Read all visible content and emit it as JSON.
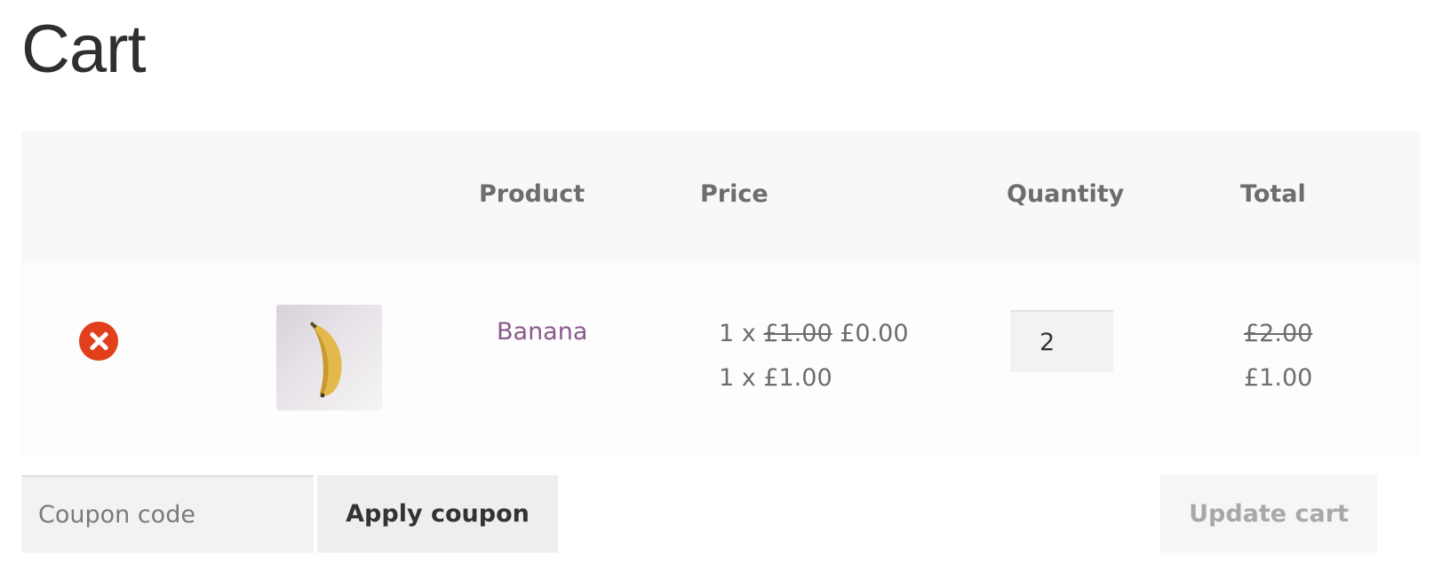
{
  "page": {
    "title": "Cart"
  },
  "table": {
    "headers": {
      "product": "Product",
      "price": "Price",
      "quantity": "Quantity",
      "total": "Total"
    },
    "rows": [
      {
        "product_name": "Banana",
        "image_icon": "banana-product-image",
        "remove_icon": "remove-circle-x-icon",
        "price_lines": [
          {
            "prefix": "1 x ",
            "original": "£1.00",
            "discounted": "£0.00"
          },
          {
            "text": "1 x £1.00"
          }
        ],
        "quantity": "2",
        "total_original": "£2.00",
        "total": "£1.00"
      }
    ]
  },
  "coupon": {
    "placeholder": "Coupon code",
    "value": "",
    "apply_label": "Apply coupon"
  },
  "update_label": "Update cart",
  "colors": {
    "remove_icon": "#e2401c",
    "product_link": "#8a5a8c",
    "header_bg": "#f8f8f8",
    "button_bg": "#eeeeee",
    "update_text_disabled": "#a8a8a8"
  }
}
